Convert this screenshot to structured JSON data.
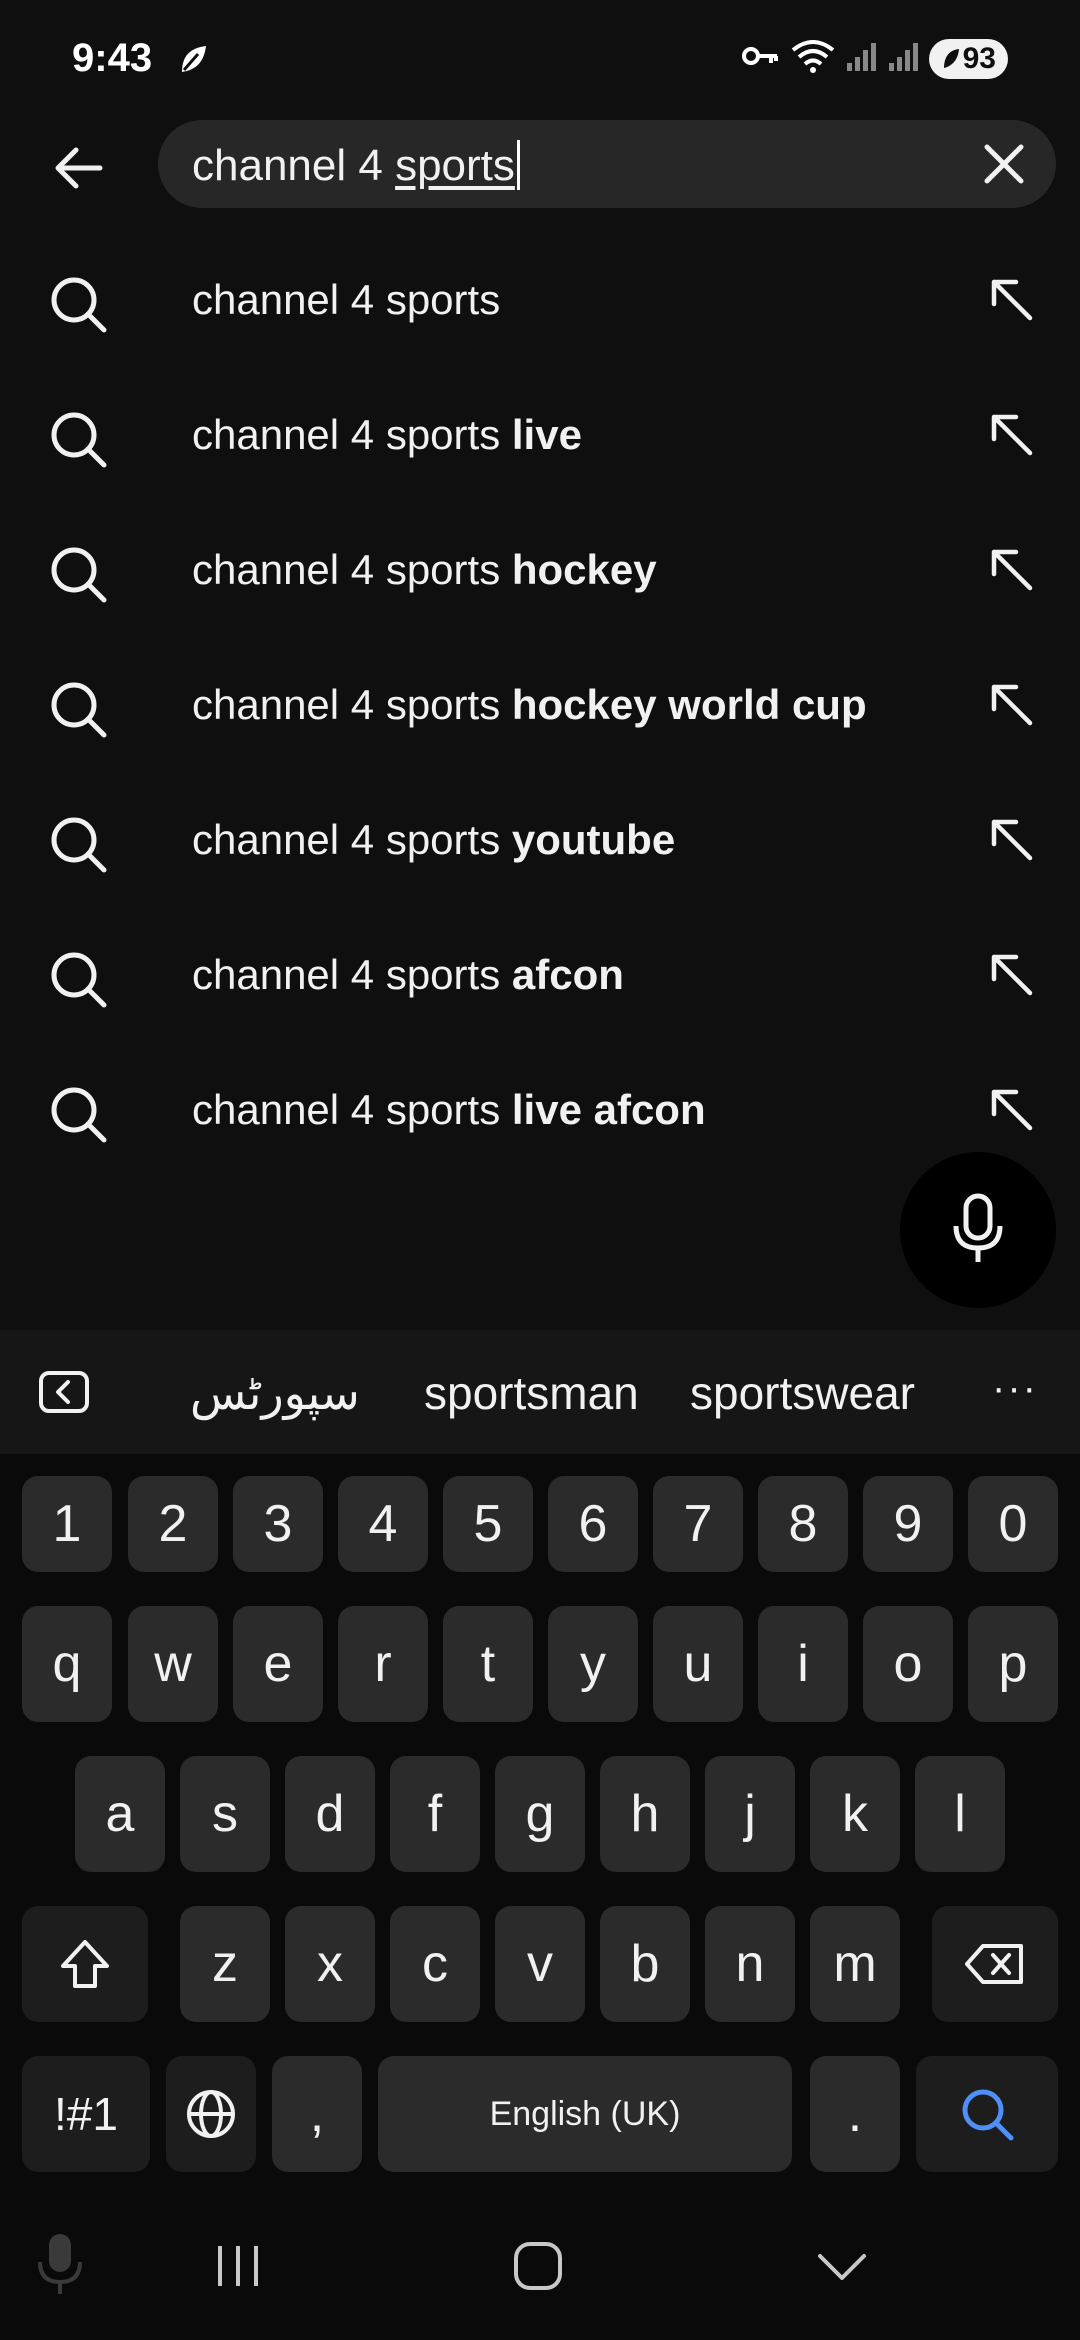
{
  "status": {
    "time": "9:43",
    "battery": "93"
  },
  "search": {
    "query_plain": "channel 4 ",
    "query_underlined": "sports"
  },
  "suggestions": [
    {
      "base": "channel 4 sports",
      "bold": ""
    },
    {
      "base": "channel 4 sports ",
      "bold": "live"
    },
    {
      "base": "channel 4 sports ",
      "bold": "hockey"
    },
    {
      "base": "channel 4 sports ",
      "bold": "hockey world cup"
    },
    {
      "base": "channel 4 sports ",
      "bold": "youtube"
    },
    {
      "base": "channel 4 sports ",
      "bold": "afcon"
    },
    {
      "base": "channel 4 sports ",
      "bold": "live afcon"
    }
  ],
  "keyboard": {
    "predictions": [
      "سپورٹس",
      "sportsman",
      "sportswear"
    ],
    "more": "···",
    "row_numbers": [
      "1",
      "2",
      "3",
      "4",
      "5",
      "6",
      "7",
      "8",
      "9",
      "0"
    ],
    "row1": [
      "q",
      "w",
      "e",
      "r",
      "t",
      "y",
      "u",
      "i",
      "o",
      "p"
    ],
    "row2": [
      "a",
      "s",
      "d",
      "f",
      "g",
      "h",
      "j",
      "k",
      "l"
    ],
    "row3": [
      "z",
      "x",
      "c",
      "v",
      "b",
      "n",
      "m"
    ],
    "symbols_label": "!#1",
    "comma": ",",
    "space_label": "English (UK)",
    "period": "."
  },
  "icons": {
    "back": "arrow-left-icon",
    "clear": "close-icon",
    "suggestion_lead": "search-icon",
    "suggestion_trail": "arrow-up-left-icon",
    "fab": "microphone-icon",
    "accent": "#4f8ff7"
  }
}
